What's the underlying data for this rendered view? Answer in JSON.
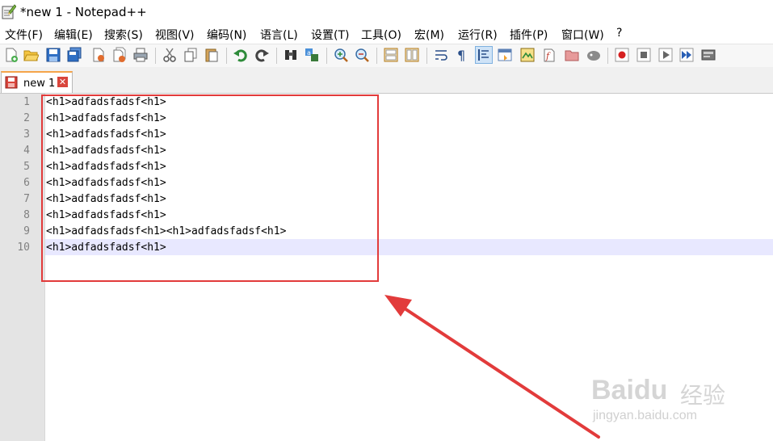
{
  "window": {
    "title": "*new 1 - Notepad++"
  },
  "menu": {
    "items": [
      "文件(F)",
      "编辑(E)",
      "搜索(S)",
      "视图(V)",
      "编码(N)",
      "语言(L)",
      "设置(T)",
      "工具(O)",
      "宏(M)",
      "运行(R)",
      "插件(P)",
      "窗口(W)",
      "?"
    ]
  },
  "toolbar": {
    "buttons": [
      "new-file-icon",
      "open-file-icon",
      "save-icon",
      "save-all-icon",
      "close-icon",
      "close-all-icon",
      "print-icon",
      "cut-icon",
      "copy-icon",
      "paste-icon",
      "undo-icon",
      "redo-icon",
      "find-icon",
      "replace-icon",
      "zoom-in-icon",
      "zoom-out-icon",
      "sync-vertical-icon",
      "sync-horizontal-icon",
      "word-wrap-icon",
      "show-all-chars-icon",
      "indent-guide-icon",
      "udl-icon",
      "doc-map-icon",
      "function-list-icon",
      "folder-workspace-icon",
      "monitoring-icon",
      "record-macro-icon",
      "stop-record-icon",
      "play-macro-icon",
      "run-macro-multiple-icon",
      "save-macro-icon"
    ]
  },
  "tab": {
    "label": "new 1",
    "close": "✕"
  },
  "editor": {
    "line_numbers": [
      "1",
      "2",
      "3",
      "4",
      "5",
      "6",
      "7",
      "8",
      "9",
      "10"
    ],
    "lines": [
      "<h1>adfadsfadsf<h1>",
      "<h1>adfadsfadsf<h1>",
      "<h1>adfadsfadsf<h1>",
      "<h1>adfadsfadsf<h1>",
      "<h1>adfadsfadsf<h1>",
      "<h1>adfadsfadsf<h1>",
      "<h1>adfadsfadsf<h1>",
      "<h1>adfadsfadsf<h1>",
      "<h1>adfadsfadsf<h1><h1>adfadsfadsf<h1>",
      "<h1>adfadsfadsf<h1>"
    ],
    "current_line": 10
  },
  "watermark": {
    "brand": "Baidu",
    "brand_cn": "经验",
    "url": "jingyan.baidu.com"
  },
  "colors": {
    "annotation": "#e23b3b",
    "current_line": "#e8e8ff",
    "gutter": "#e4e4e4"
  }
}
